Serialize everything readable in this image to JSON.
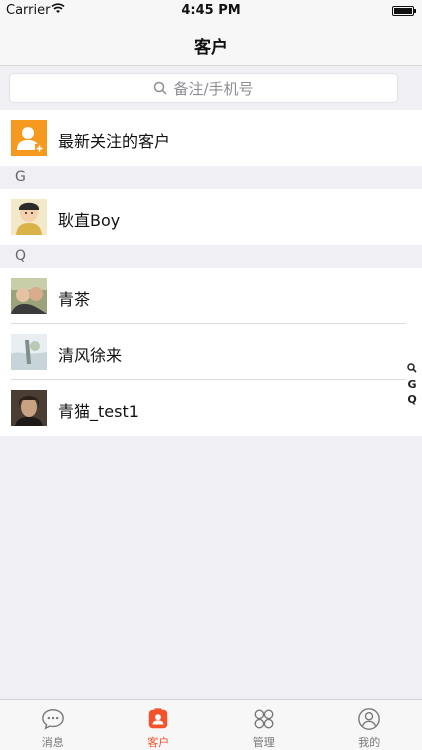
{
  "status_bar": {
    "carrier": "Carrier",
    "time": "4:45 PM"
  },
  "nav": {
    "title": "客户"
  },
  "search": {
    "placeholder": "备注/手机号"
  },
  "new_follow": {
    "label": "最新关注的客户"
  },
  "sections": [
    {
      "header": "G",
      "items": [
        {
          "name": "耿直Boy"
        }
      ]
    },
    {
      "header": "Q",
      "items": [
        {
          "name": "青茶"
        },
        {
          "name": "清风徐来"
        },
        {
          "name": "青猫_test1"
        }
      ]
    }
  ],
  "index": [
    "G",
    "Q"
  ],
  "tabs": [
    {
      "label": "消息",
      "icon": "chat-bubble-icon"
    },
    {
      "label": "客户",
      "icon": "contact-card-icon",
      "active": true
    },
    {
      "label": "管理",
      "icon": "grid-petals-icon"
    },
    {
      "label": "我的",
      "icon": "user-circle-icon"
    }
  ],
  "colors": {
    "accent": "#f3522a",
    "new_follow_icon": "#f59a1e",
    "background": "#efeff4"
  }
}
